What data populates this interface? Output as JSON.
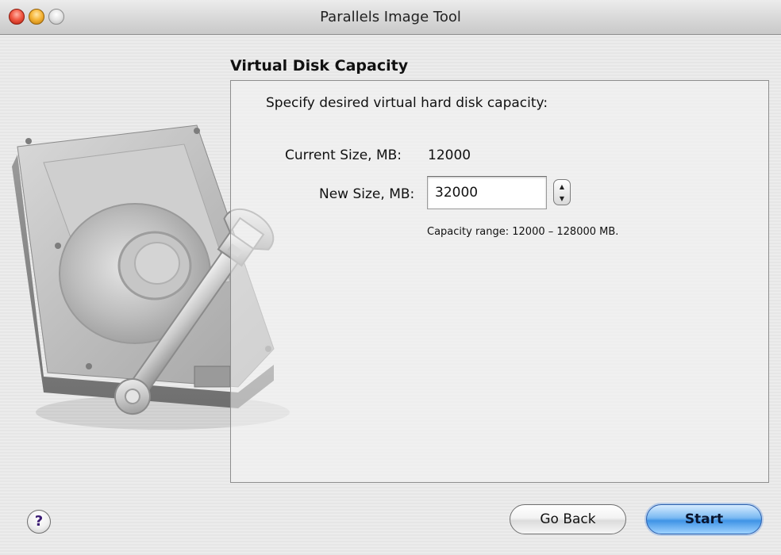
{
  "window": {
    "title": "Parallels Image Tool"
  },
  "section": {
    "title": "Virtual Disk Capacity"
  },
  "form": {
    "prompt": "Specify desired virtual hard disk capacity:",
    "current_size_label": "Current Size, MB:",
    "current_size_value": "12000",
    "new_size_label": "New Size, MB:",
    "new_size_value": "32000",
    "capacity_range": "Capacity range: 12000 – 128000 MB."
  },
  "buttons": {
    "help_label": "?",
    "back_label": "Go Back",
    "start_label": "Start"
  },
  "icons": {
    "close": "close-button",
    "minimize": "minimize-button",
    "zoom": "zoom-button",
    "artwork": "hard-disk-with-wrench-icon"
  },
  "colors": {
    "start_accent": "#3f93e6",
    "help_glyph": "#3a1a73"
  }
}
